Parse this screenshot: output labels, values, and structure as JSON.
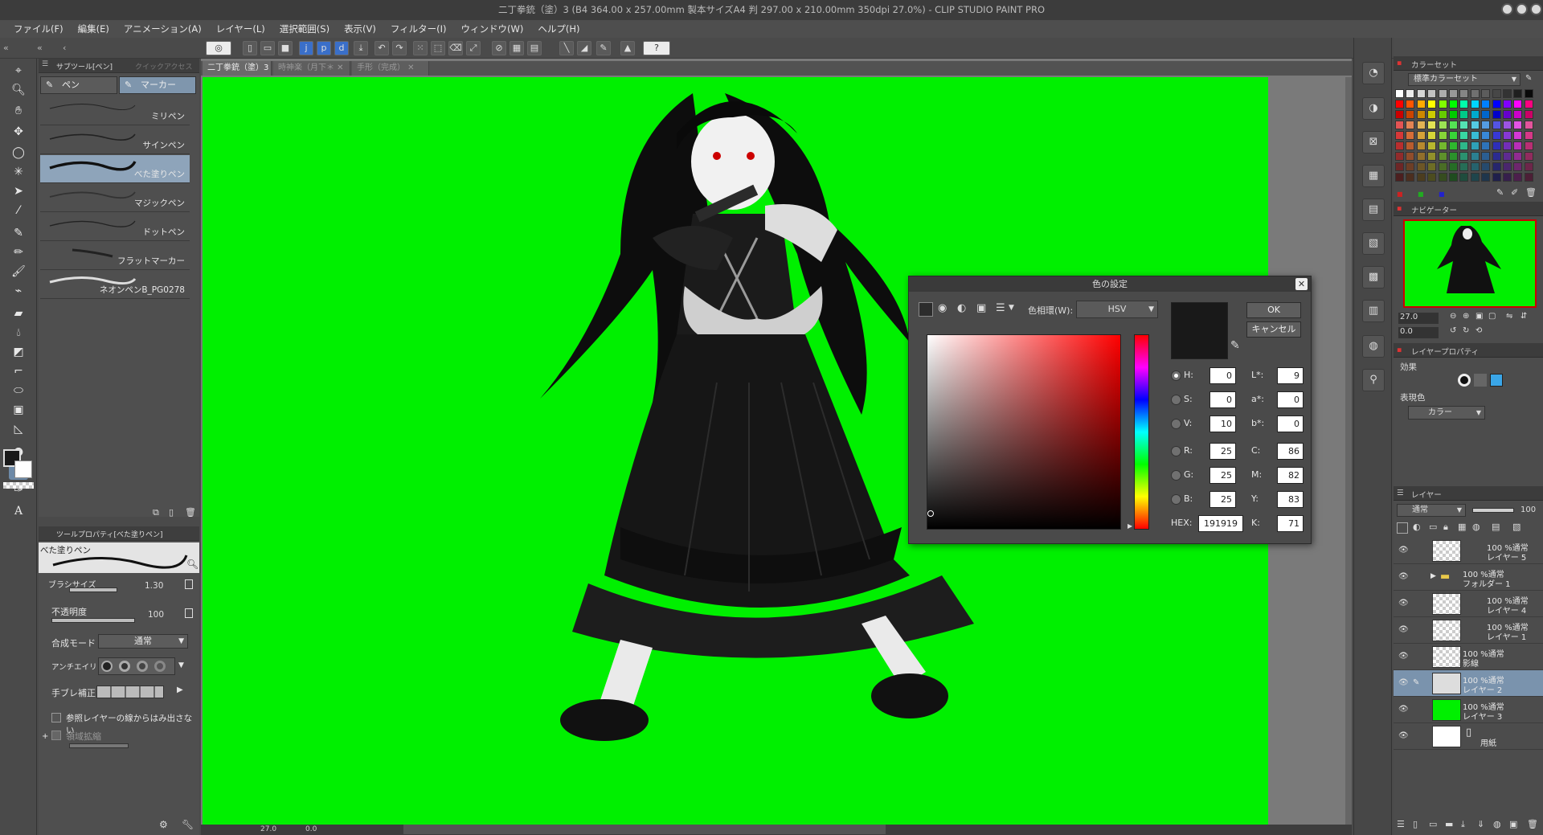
{
  "window": {
    "title": "二丁拳銃（塗）3 (B4 364.00 x 257.00mm 製本サイズA4 判 297.00 x 210.00mm 350dpi 27.0%) - CLIP STUDIO PAINT PRO"
  },
  "menu": [
    "ファイル(F)",
    "編集(E)",
    "アニメーション(A)",
    "レイヤー(L)",
    "選択範囲(S)",
    "表示(V)",
    "フィルター(I)",
    "ウィンドウ(W)",
    "ヘルプ(H)"
  ],
  "subtool_panel": {
    "tabs": [
      "サブツール[ペン]",
      "クイックアクセス"
    ],
    "groups": [
      "ペン",
      "マーカー"
    ],
    "brushes": [
      "ミリペン",
      "サインペン",
      "べた塗りペン",
      "マジックペン",
      "ドットペン",
      "フラットマーカー",
      "ネオンペンB_PG0278"
    ],
    "selected_brush": "べた塗りペン"
  },
  "tool_property": {
    "tab": "ツールプロパティ[べた塗りペン]",
    "brush_name": "べた塗りペン",
    "brush_size_label": "ブラシサイズ",
    "brush_size_value": "1.30",
    "opacity_label": "不透明度",
    "opacity_value": "100",
    "blend_label": "合成モード",
    "blend_value": "通常",
    "antialias_label": "アンチエイリアス",
    "stabilization_label": "手ブレ補正",
    "ref_layer_label": "参照レイヤーの線からはみ出さない",
    "area_scale_label": "領域拡縮"
  },
  "document_tabs": [
    "二丁拳銃（塗）3",
    "時神楽（月下＊",
    "手形（完成）"
  ],
  "status_bar": {
    "zoom": "27.0",
    "angle": "0.0"
  },
  "color_dialog": {
    "title": "色の設定",
    "color_space_label": "色相環(W):",
    "color_space_value": "HSV",
    "current_color": "#191919",
    "fields": {
      "H": "0",
      "S": "0",
      "V": "10",
      "R": "25",
      "G": "25",
      "B": "25",
      "L": "9",
      "a": "0",
      "b": "0",
      "C": "86",
      "M": "82",
      "Y": "83",
      "K": "71"
    },
    "labels": {
      "H": "H:",
      "S": "S:",
      "V": "V:",
      "R": "R:",
      "G": "G:",
      "B": "B:",
      "L": "L*:",
      "a": "a*:",
      "b": "b*:",
      "C": "C:",
      "M": "M:",
      "Y": "Y:",
      "K": "K:",
      "HEX": "HEX:"
    },
    "hex": "191919",
    "ok_label": "OK",
    "cancel_label": "キャンセル"
  },
  "color_set_panel": {
    "tab": "カラーセット",
    "set_name": "標準カラーセット"
  },
  "navigator_panel": {
    "tab": "ナビゲーター",
    "zoom": "27.0",
    "angle": "0.0"
  },
  "layer_property_panel": {
    "tab": "レイヤープロパティ",
    "effect_label": "効果",
    "express_color_label": "表現色",
    "express_color_value": "カラー"
  },
  "layer_panel": {
    "tab": "レイヤー",
    "blend_mode": "通常",
    "opacity": "100",
    "layers": [
      {
        "l1": "100 %通常",
        "l2": "レイヤー 5",
        "thumb": "checker"
      },
      {
        "l1": "100 %通常",
        "l2": "フォルダー 1",
        "thumb": "folder"
      },
      {
        "l1": "100 %通常",
        "l2": "レイヤー 4",
        "thumb": "checker"
      },
      {
        "l1": "100 %通常",
        "l2": "レイヤー 1",
        "thumb": "checker"
      },
      {
        "l1": "100 %通常",
        "l2": "影線",
        "thumb": "checker"
      },
      {
        "l1": "100 %通常",
        "l2": "レイヤー 2",
        "thumb": "figure"
      },
      {
        "l1": "100 %通常",
        "l2": "レイヤー 3",
        "thumb": "green"
      },
      {
        "l1": "",
        "l2": "用紙",
        "thumb": "white"
      }
    ],
    "selected_index": 5
  },
  "colors": {
    "canvas_bg": "#00f000",
    "accent": "#7a93ad",
    "main_color": "#191919",
    "sub_color": "#ffffff"
  }
}
